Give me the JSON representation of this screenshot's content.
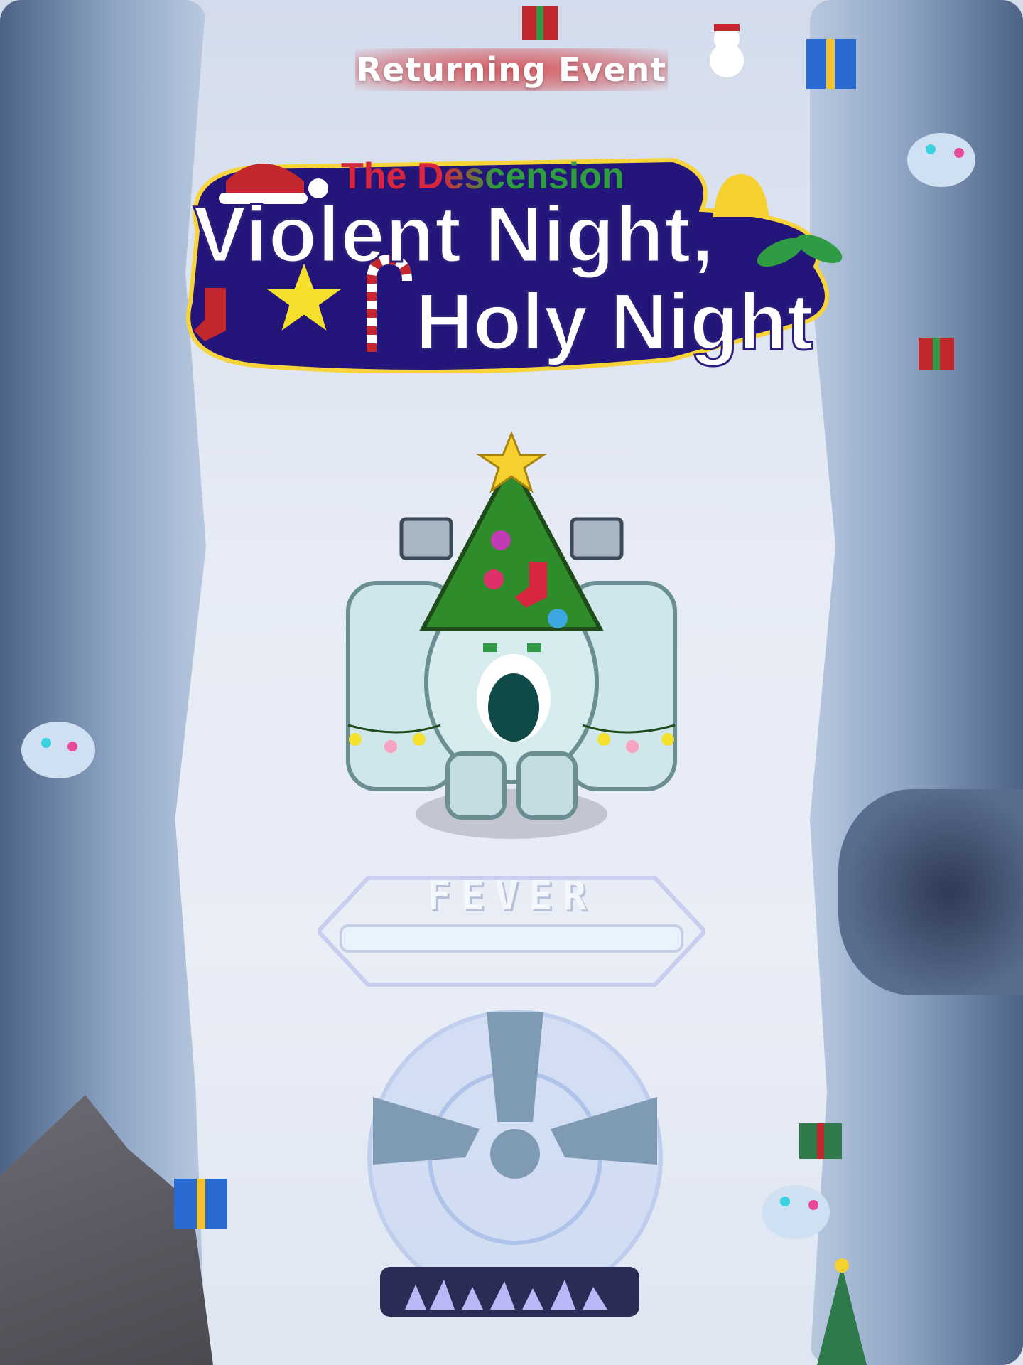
{
  "banner": {
    "text": "Returning Event",
    "color": "#d64448"
  },
  "event_logo": {
    "subtitle": "The Descension",
    "title_line1": "Violent Night,",
    "title_line2": "Holy Night",
    "outline_color": "#2a1f7a"
  },
  "fever": {
    "label": "FEVER",
    "progress": 0.0
  },
  "icons": {
    "banner": "ribbon-banner",
    "logo": "santa-hat-icon",
    "boss": "yeti-christmas-tree-boss",
    "attack": "tap-attack-button-icon",
    "charges": "crystal-charge-bar-icon"
  }
}
